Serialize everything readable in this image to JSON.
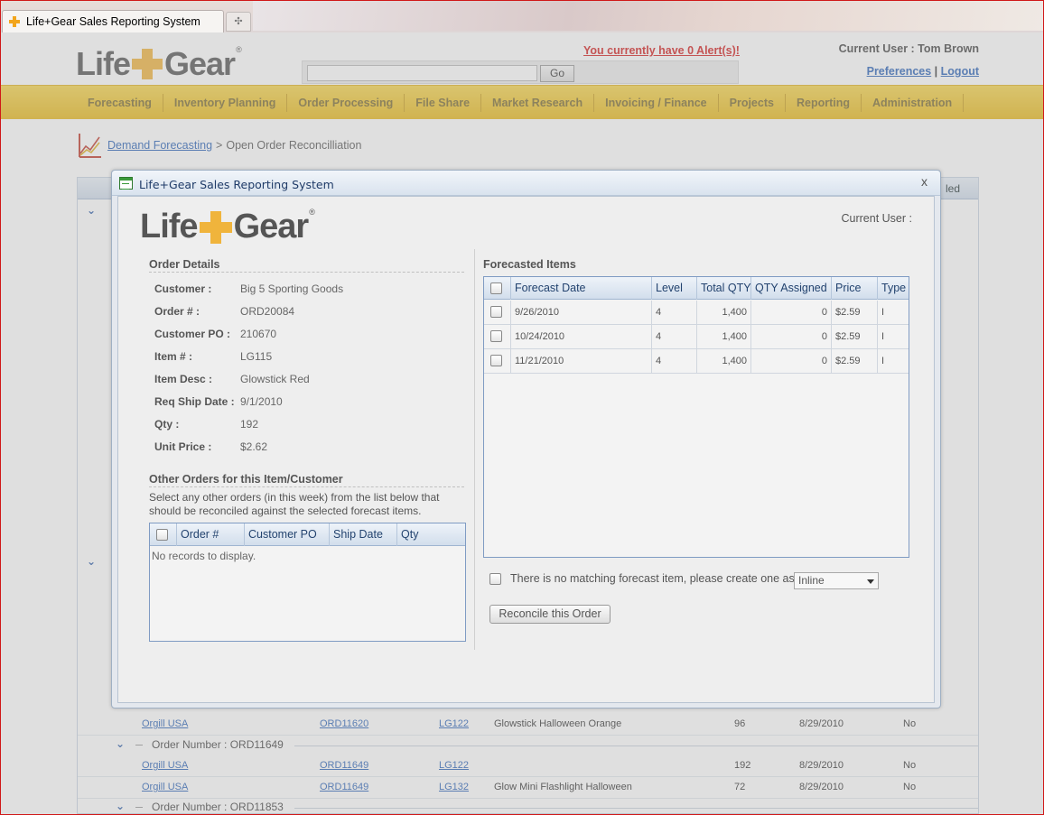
{
  "browser": {
    "tab_title": "Life+Gear Sales Reporting System",
    "new_tab_symbol": "✣"
  },
  "header": {
    "logo_left": "Life",
    "logo_right": "Gear",
    "logo_reg": "®",
    "search_value": "",
    "go_label": "Go",
    "alerts_text": "You currently have 0 Alert(s)!",
    "current_user": "Current User : Tom Brown",
    "preferences_label": "Preferences",
    "separator": "|",
    "logout_label": "Logout"
  },
  "nav": {
    "items": [
      "Forecasting",
      "Inventory Planning",
      "Order Processing",
      "File Share",
      "Market Research",
      "Invoicing / Finance",
      "Projects",
      "Reporting",
      "Administration"
    ]
  },
  "breadcrumb": {
    "link": "Demand Forecasting",
    "separator": ">",
    "current": "Open Order Reconcilliation"
  },
  "background_grid": {
    "header_fragment": "led",
    "groups": [
      {
        "label": "Order Number : ORD11649"
      },
      {
        "label": "Order Number : ORD11853"
      }
    ],
    "rows": [
      {
        "customer": "Orgill USA",
        "order": "ORD11620",
        "item": "LG122",
        "desc": "Glowstick Halloween Orange",
        "qty": "96",
        "date": "8/29/2010",
        "flag": "No"
      },
      {
        "customer": "Orgill USA",
        "order": "ORD11649",
        "item": "LG122",
        "desc": "",
        "qty": "192",
        "date": "8/29/2010",
        "flag": "No"
      },
      {
        "customer": "Orgill USA",
        "order": "ORD11649",
        "item": "LG132",
        "desc": "Glow Mini Flashlight Halloween",
        "qty": "72",
        "date": "8/29/2010",
        "flag": "No"
      }
    ]
  },
  "modal": {
    "title": "Life+Gear Sales Reporting System",
    "close_symbol": "x",
    "current_user_label": "Current User :",
    "order_details_title": "Order Details",
    "details": [
      {
        "label": "Customer :",
        "value": "Big 5 Sporting Goods"
      },
      {
        "label": "Order # :",
        "value": "ORD20084"
      },
      {
        "label": "Customer PO :",
        "value": "210670"
      },
      {
        "label": "Item # :",
        "value": "LG115"
      },
      {
        "label": "Item Desc :",
        "value": "Glowstick Red"
      },
      {
        "label": "Req Ship Date :",
        "value": "9/1/2010"
      },
      {
        "label": "Qty :",
        "value": "192"
      },
      {
        "label": "Unit Price :",
        "value": "$2.62"
      }
    ],
    "other_orders_title": "Other Orders for this Item/Customer",
    "other_orders_help": "Select any other orders (in this week) from the list below that should be reconciled against the selected forecast items.",
    "other_orders_columns": [
      "Order #",
      "Customer PO",
      "Ship Date",
      "Qty"
    ],
    "other_orders_empty": "No records to display.",
    "forecasted_title": "Forecasted Items",
    "forecast_columns": [
      "Forecast Date",
      "Level",
      "Total QTY",
      "QTY Assigned",
      "Price",
      "Type"
    ],
    "forecast_rows": [
      {
        "date": "9/26/2010",
        "level": "4",
        "total": "1,400",
        "assigned": "0",
        "price": "$2.59",
        "type": "I"
      },
      {
        "date": "10/24/2010",
        "level": "4",
        "total": "1,400",
        "assigned": "0",
        "price": "$2.59",
        "type": "I"
      },
      {
        "date": "11/21/2010",
        "level": "4",
        "total": "1,400",
        "assigned": "0",
        "price": "$2.59",
        "type": "I"
      }
    ],
    "no_match_text": "There is no matching forecast item, please create one as",
    "create_as_value": "Inline",
    "reconcile_label": "Reconcile this Order"
  }
}
